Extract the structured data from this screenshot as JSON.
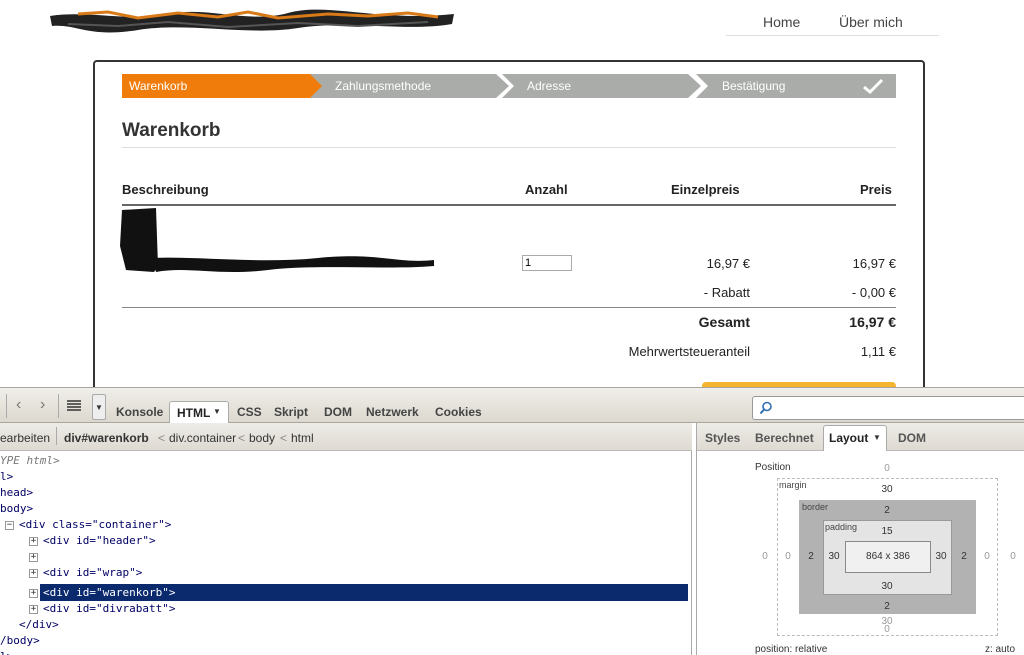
{
  "nav": {
    "home": "Home",
    "about": "Über mich"
  },
  "steps": [
    {
      "label": "Warenkorb",
      "active": true
    },
    {
      "label": "Zahlungsmethode",
      "active": false
    },
    {
      "label": "Adresse",
      "active": false
    },
    {
      "label": "Bestätigung",
      "active": false
    }
  ],
  "colors": {
    "step_active": "#f07d0b",
    "step_inactive": "#a9aca8",
    "selection": "#0b2a6e",
    "checkout": "#f4b42f"
  },
  "cart": {
    "title": "Warenkorb",
    "headers": {
      "description": "Beschreibung",
      "quantity": "Anzahl",
      "unit_price": "Einzelpreis",
      "price": "Preis"
    },
    "item": {
      "quantity": "1",
      "unit_price": "16,97 €",
      "price": "16,97 €"
    },
    "discount": {
      "label": "- Rabatt",
      "value": "- 0,00 €"
    },
    "total": {
      "label": "Gesamt",
      "value": "16,97 €"
    },
    "vat": {
      "label": "Mehrwertsteueranteil",
      "value": "1,11 €"
    }
  },
  "devtools": {
    "tabs": [
      "Konsole",
      "HTML",
      "CSS",
      "Skript",
      "DOM",
      "Netzwerk",
      "Cookies"
    ],
    "breadcrumbs": [
      "earbeiten",
      "div#warenkorb",
      "div.container",
      "body",
      "html"
    ],
    "side_tabs": [
      "Styles",
      "Berechnet",
      "Layout",
      "DOM"
    ],
    "dom": {
      "doctype": "YPE html>",
      "l1": "l>",
      "head": "head>",
      "body": "body>",
      "container_open": "<div class=\"container\">",
      "header": "<div id=\"header\">",
      "warenkorb": "<div id=\"warenkorb\">",
      "wrap": "<div id=\"wrap\">",
      "divrabatt": "<div id=\"divrabatt\">",
      "div_close": "</div>",
      "body_close": "/body>",
      "html_close": "l>"
    },
    "layout": {
      "position_label": "Position",
      "margin_label": "margin",
      "border_label": "border",
      "padding_label": "padding",
      "position": {
        "top": "0",
        "bottom": "0",
        "left": "0",
        "right": "0"
      },
      "margin": {
        "top": "30",
        "bottom": "30",
        "left": "0",
        "right": "0"
      },
      "border": {
        "top": "2",
        "bottom": "2",
        "left": "2",
        "right": "2"
      },
      "padding": {
        "top": "15",
        "bottom": "30",
        "left": "30",
        "right": "30"
      },
      "content": "864 x 386",
      "position_value": "position: relative",
      "z_index": "z: auto"
    }
  }
}
